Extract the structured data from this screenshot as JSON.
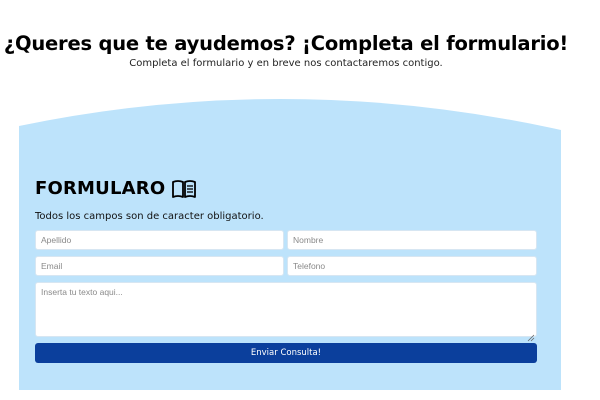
{
  "hero": {
    "title": "¿Queres que te ayudemos? ¡Completa el formulario!",
    "subtitle": "Completa el formulario y en breve nos contactaremos contigo."
  },
  "form": {
    "title": "FORMULARO",
    "title_icon": "book-icon",
    "required_note": "Todos los campos son de caracter obligatorio.",
    "fields": {
      "apellido_placeholder": "Apellido",
      "nombre_placeholder": "Nombre",
      "email_placeholder": "Email",
      "telefono_placeholder": "Telefono",
      "message_placeholder": "Inserta tu texto aqui..."
    },
    "submit_label": "Enviar Consulta!"
  },
  "colors": {
    "panel_background": "#bde3fb",
    "button_background": "#0b3f9c",
    "button_text": "#ffffff",
    "input_background": "#ffffff"
  }
}
